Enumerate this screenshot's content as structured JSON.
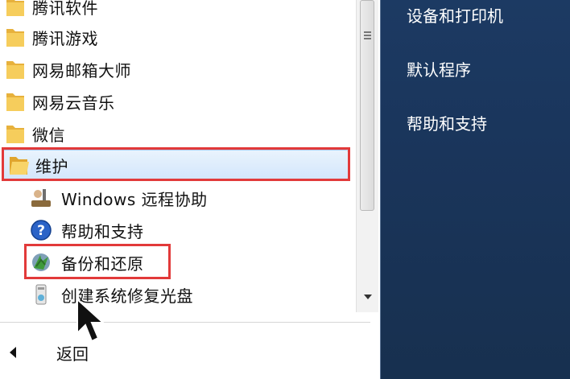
{
  "left_panel": {
    "folders": [
      {
        "label": "腾讯软件"
      },
      {
        "label": "腾讯游戏"
      },
      {
        "label": "网易邮箱大师"
      },
      {
        "label": "网易云音乐"
      },
      {
        "label": "微信"
      },
      {
        "label": "维护",
        "selected": true
      }
    ],
    "sub_items": [
      {
        "label": "Windows 远程协助"
      },
      {
        "label": "帮助和支持"
      },
      {
        "label": "备份和还原"
      },
      {
        "label": "创建系统修复光盘"
      }
    ],
    "back_label": "返回"
  },
  "right_panel": {
    "items": [
      {
        "label": "设备和打印机"
      },
      {
        "label": "默认程序"
      },
      {
        "label": "帮助和支持"
      }
    ]
  },
  "colors": {
    "highlight_box": "#e23a3a",
    "right_panel_bg": "#1a355b",
    "folder_yellow": "#f2c14e"
  }
}
